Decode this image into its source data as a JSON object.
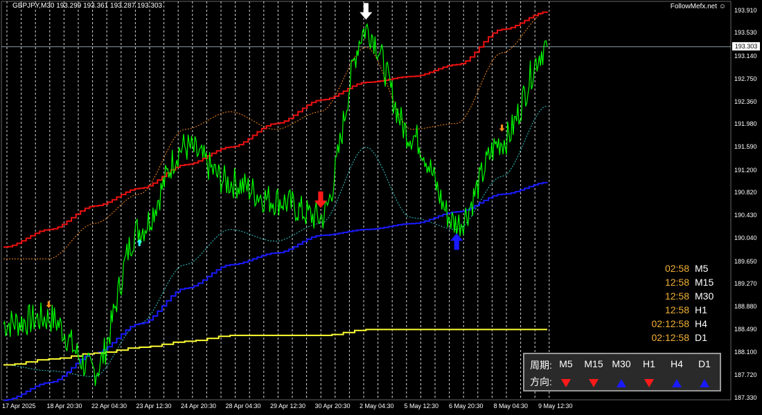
{
  "symbol": "GBPJPY,M30",
  "ohlc": "193.299 193.361 193.287 193.303",
  "watermark": "FollowMefx.net",
  "smiley_icon": "smiley-icon",
  "price_scale": [
    "193.910",
    "193.530",
    "193.140",
    "192.750",
    "192.360",
    "191.980",
    "191.590",
    "191.200",
    "190.820",
    "190.430",
    "190.040",
    "189.650",
    "189.270",
    "188.880",
    "188.490",
    "188.100",
    "187.720",
    "187.330"
  ],
  "current_price": "193.303",
  "time_axis": [
    "17 Apr 2025",
    "18 Apr 20:30",
    "22 Apr 04:30",
    "23 Apr 12:30",
    "24 Apr 20:30",
    "28 Apr 04:30",
    "29 Apr 12:30",
    "30 Apr 20:30",
    "2 May 04:30",
    "5 May 12:30",
    "6 May 20:30",
    "8 May 04:30",
    "9 May 12:30"
  ],
  "timers": [
    {
      "value": "02:58",
      "tf": "M5"
    },
    {
      "value": "12:58",
      "tf": "M15"
    },
    {
      "value": "12:58",
      "tf": "M30"
    },
    {
      "value": "12:58",
      "tf": "H1"
    },
    {
      "value": "02:12:58",
      "tf": "H4"
    },
    {
      "value": "02:12:58",
      "tf": "D1"
    }
  ],
  "direction_panel": {
    "period_label": "周期:",
    "direction_label": "方向:",
    "timeframes": [
      "M5",
      "M15",
      "M30",
      "H1",
      "H4",
      "D1"
    ],
    "directions": [
      "down",
      "down",
      "up",
      "down",
      "up",
      "up"
    ]
  },
  "colors": {
    "price": "#00ff00",
    "ma_red": "#ee1111",
    "ma_blue": "#1a1aff",
    "ma_yellow": "#ffff33",
    "band_orange": "#ff8c1a",
    "band_cyan": "#33cccc",
    "grid": "#ffffff",
    "timer": "#f2b134"
  },
  "chart_data": {
    "type": "line",
    "ylim": [
      187.33,
      193.91
    ],
    "current_price": 193.303,
    "x": [
      "17 Apr 2025",
      "18 Apr 20:30",
      "22 Apr 04:30",
      "23 Apr 12:30",
      "24 Apr 20:30",
      "28 Apr 04:30",
      "29 Apr 12:30",
      "30 Apr 20:30",
      "2 May 04:30",
      "5 May 12:30",
      "6 May 20:30",
      "8 May 04:30",
      "9 May 12:30"
    ],
    "series": [
      {
        "values": [
          188.6,
          188.7,
          187.8,
          190.2,
          191.6,
          191.0,
          190.7,
          190.4,
          193.6,
          191.8,
          190.3,
          191.7,
          193.3
        ]
      },
      {
        "values": [
          189.9,
          190.2,
          190.6,
          190.9,
          191.3,
          191.6,
          192.0,
          192.4,
          192.7,
          192.8,
          193.0,
          193.6,
          193.9
        ]
      },
      {
        "values": [
          187.3,
          187.6,
          188.1,
          188.6,
          189.2,
          189.6,
          189.8,
          190.1,
          190.2,
          190.3,
          190.5,
          190.8,
          191.0
        ]
      },
      {
        "values": [
          187.9,
          188.0,
          188.1,
          188.2,
          188.3,
          188.4,
          188.4,
          188.4,
          188.5,
          188.5,
          188.5,
          188.5,
          188.5
        ]
      },
      {
        "values": [
          189.7,
          189.7,
          190.3,
          190.8,
          191.9,
          192.2,
          191.9,
          192.2,
          193.3,
          191.9,
          192.0,
          193.2,
          193.9
        ]
      },
      {
        "values": [
          187.9,
          187.8,
          187.7,
          188.6,
          189.6,
          190.2,
          190.0,
          190.3,
          191.6,
          190.4,
          190.2,
          191.1,
          192.3
        ]
      }
    ],
    "arrows": [
      {
        "x": "18 Apr 20:30",
        "dir": "down",
        "color": "#ff8c1a"
      },
      {
        "x": "23 Apr 12:30",
        "dir": "up",
        "color": "#33ffff"
      },
      {
        "x": "30 Apr 20:30",
        "dir": "down",
        "color": "#ff1a1a"
      },
      {
        "x": "2 May 04:30",
        "dir": "down",
        "color": "#ffffff"
      },
      {
        "x": "6 May 20:30",
        "dir": "up",
        "color": "#1a1aff"
      },
      {
        "x": "8 May 04:30",
        "dir": "down",
        "color": "#ff8c1a"
      }
    ]
  }
}
